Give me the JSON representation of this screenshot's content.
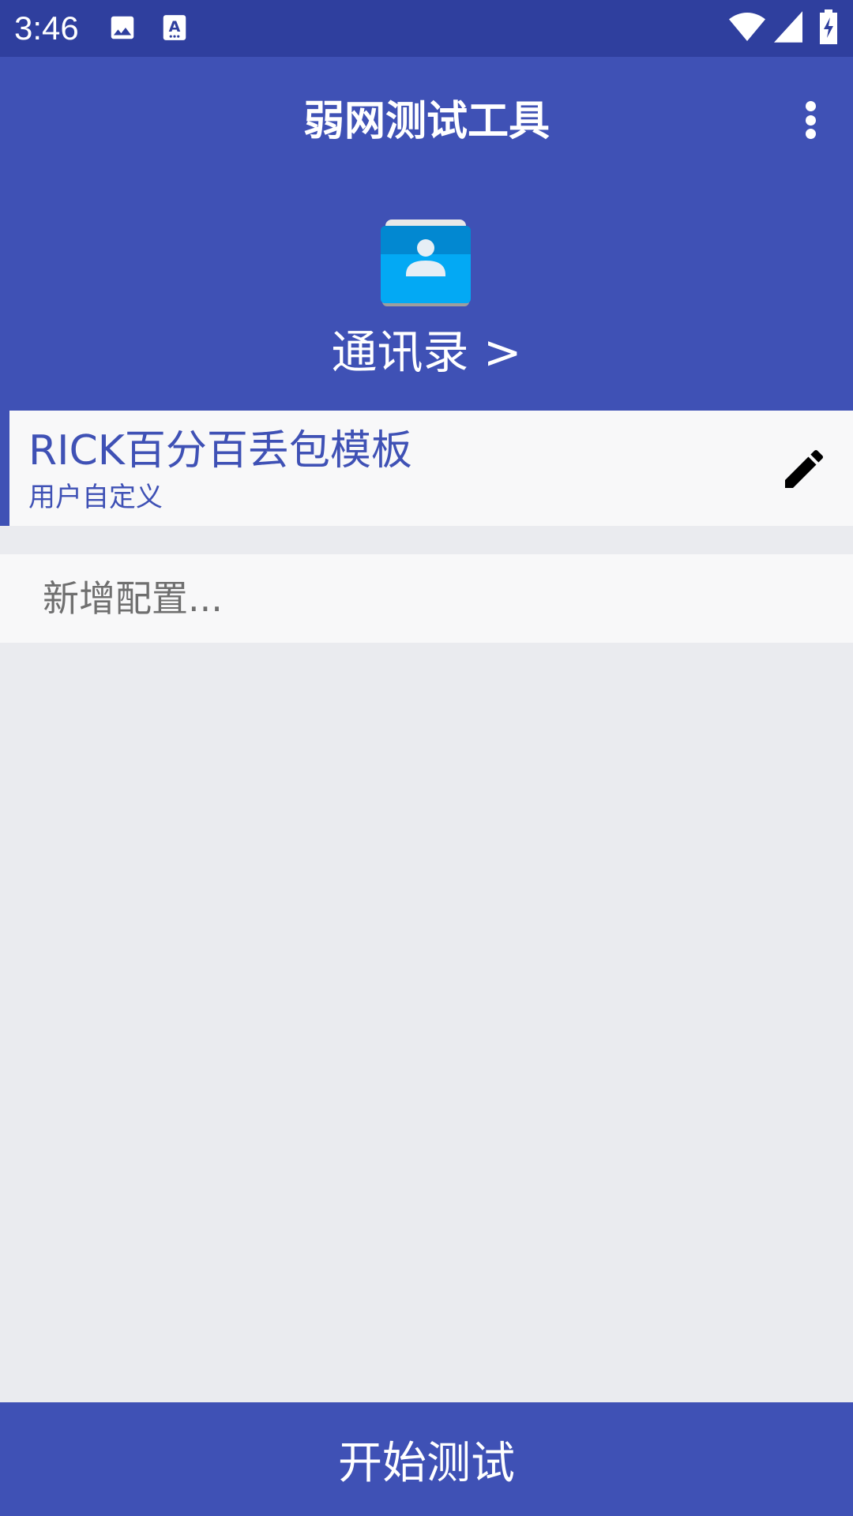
{
  "status_bar": {
    "time": "3:46",
    "icons": [
      "image-icon",
      "text-recognition-icon",
      "wifi-icon",
      "signal-icon",
      "battery-charging-icon"
    ]
  },
  "app_bar": {
    "title": "弱网测试工具",
    "menu_icon": "more-vert-icon"
  },
  "header": {
    "icon": "contacts-icon",
    "contacts_link": "通讯录 >"
  },
  "config_card": {
    "name": "RICK百分百丢包模板",
    "subtitle": "用户自定义",
    "edit_icon": "pencil-icon"
  },
  "add_config": {
    "label": "新增配置..."
  },
  "footer": {
    "start_button": "开始测试"
  },
  "colors": {
    "status_bar": "#2f3f9e",
    "primary": "#3f51b5",
    "background": "#eaebef",
    "card": "#f8f8f9"
  }
}
